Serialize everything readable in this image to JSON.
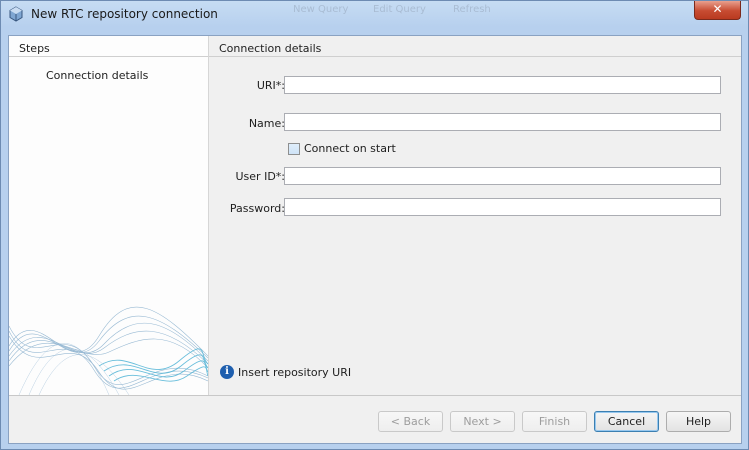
{
  "window": {
    "title": "New RTC repository connection",
    "ghost_toolbar": [
      "New Query",
      "Edit Query",
      "Refresh"
    ],
    "close_glyph": "✕"
  },
  "steps": {
    "heading": "Steps",
    "items": [
      "Connection details"
    ]
  },
  "panel": {
    "heading": "Connection details",
    "fields": {
      "uri_label": "URI*:",
      "uri_value": "",
      "name_label": "Name:",
      "name_value": "",
      "connect_on_start_label": "Connect on start",
      "connect_on_start_checked": false,
      "userid_label": "User ID*:",
      "userid_value": "",
      "password_label": "Password:",
      "password_value": ""
    },
    "info_message": "Insert repository URI"
  },
  "buttons": {
    "back": "< Back",
    "next": "Next >",
    "finish": "Finish",
    "cancel": "Cancel",
    "help": "Help"
  },
  "colors": {
    "titlebar": "#b7d0ee",
    "close_button": "#c74b31",
    "info_icon": "#1f5fae",
    "wave_accent": "#5ab8d8"
  }
}
